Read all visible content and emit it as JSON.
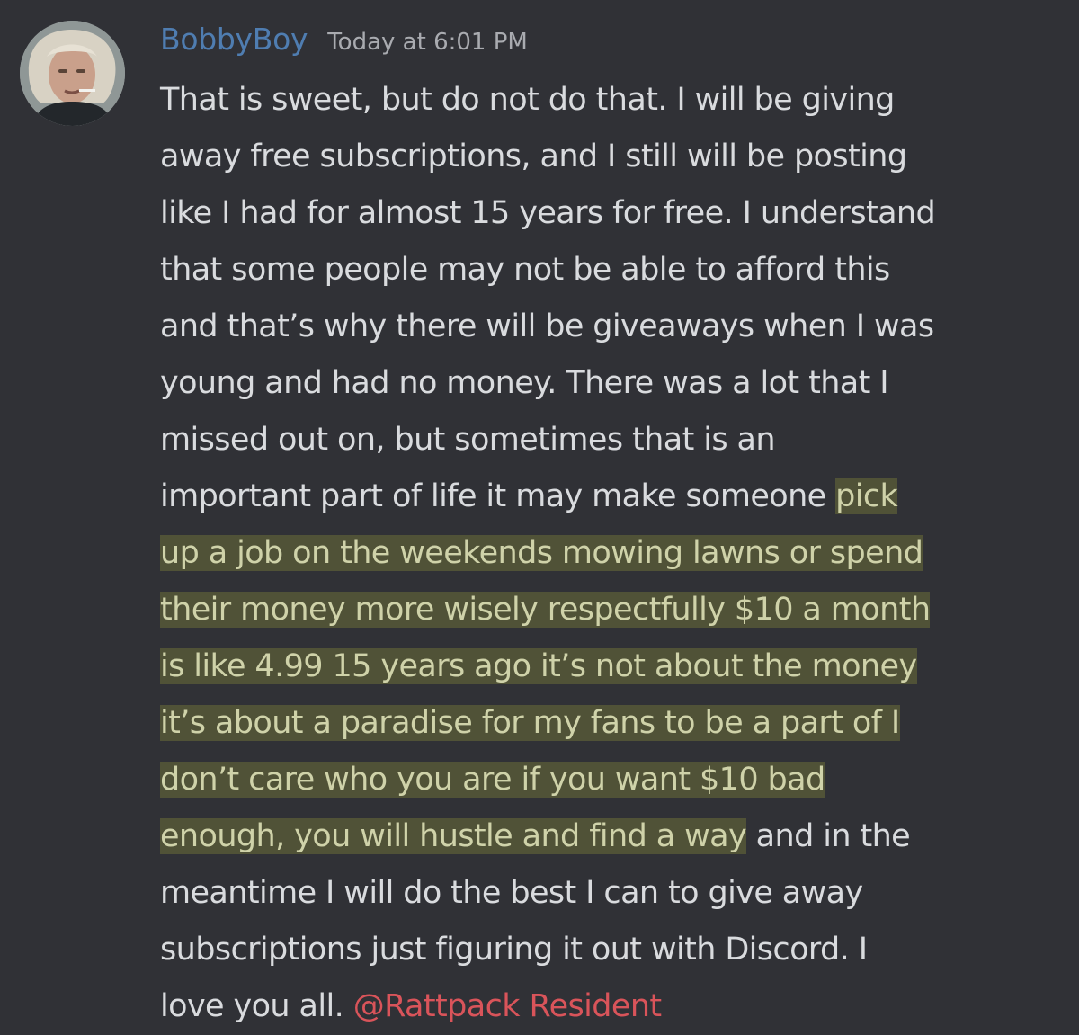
{
  "message": {
    "username": "BobbyBoy",
    "timestamp": "Today at 6:01 PM",
    "lines": [
      "That is sweet, but do not do that. I will be giving",
      "away free subscriptions, and I still will be posting",
      "like I had for almost 15 years for free. I understand",
      "that some people may not be able to afford this",
      "and that’s why there will be giveaways when I was",
      "young and had no money. There was a lot that I",
      "missed out on, but sometimes that is an",
      "important part of life it may make someone "
    ],
    "line8_highlight": "pick",
    "highlighted_lines": [
      "up a job on the weekends mowing lawns or spend",
      "their money more wisely respectfully $10 a month",
      "is like 4.99 15 years ago it’s not about the money",
      "it’s about a paradise for my fans to be a part of I",
      "don’t care who you are if you want $10 bad"
    ],
    "line14_highlight": "enough, you will hustle and find a way",
    "line14_rest": " and in the",
    "tail_lines": [
      "meantime I will do the best I can to give away",
      "subscriptions just figuring it out with Discord. I"
    ],
    "last_line_text": "love you all. ",
    "mention": "@Rattpack Resident"
  },
  "colors": {
    "background": "#303136",
    "username": "#4f7db1",
    "text": "#d9dbde",
    "timestamp": "#a9abb0",
    "mention": "#d9545a",
    "highlight": "#c4c93c"
  },
  "icons": {
    "avatar": "user-avatar-photo"
  }
}
